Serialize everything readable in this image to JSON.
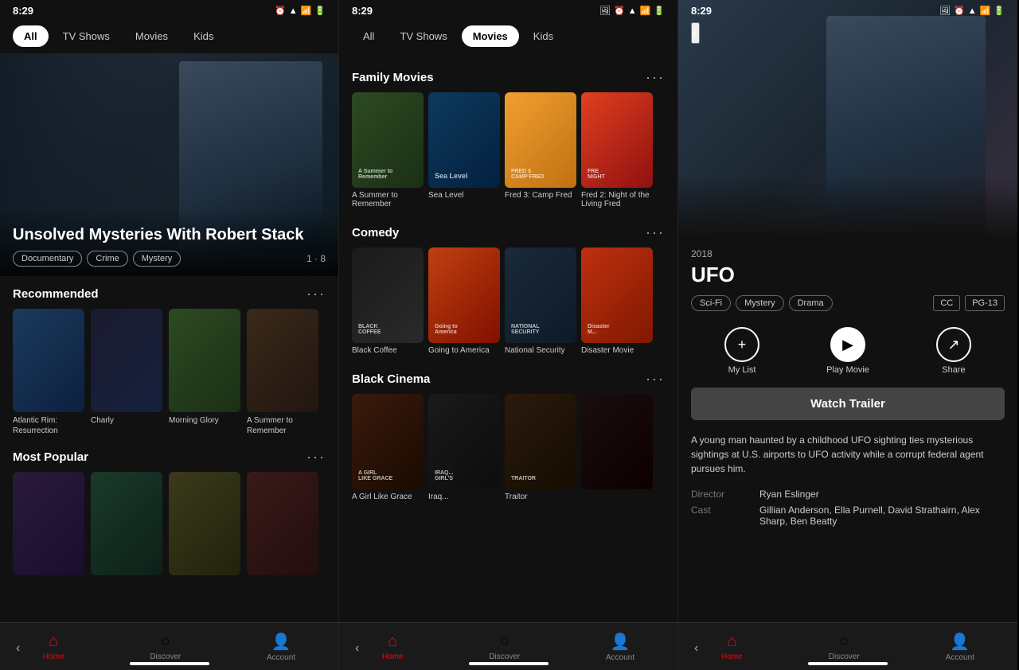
{
  "app": {
    "time": "8:29"
  },
  "panel1": {
    "tabs": [
      "All",
      "TV Shows",
      "Movies",
      "Kids"
    ],
    "active_tab": "All",
    "hero": {
      "title": "Unsolved Mysteries With Robert Stack",
      "tags": [
        "Documentary",
        "Crime",
        "Mystery"
      ],
      "episode": "1 · 8"
    },
    "recommended": {
      "title": "Recommended",
      "movies": [
        {
          "title": "Atlantic Rim: Resurrection",
          "thumb_class": "thumb-1"
        },
        {
          "title": "Charly",
          "thumb_class": "thumb-2"
        },
        {
          "title": "Morning Glory",
          "thumb_class": "thumb-3"
        },
        {
          "title": "A Summer to Remember",
          "thumb_class": "thumb-4"
        }
      ]
    },
    "most_popular": {
      "title": "Most Popular",
      "movies": [
        {
          "title": "",
          "thumb_class": "thumb-5"
        },
        {
          "title": "",
          "thumb_class": "thumb-6"
        },
        {
          "title": "",
          "thumb_class": "thumb-7"
        },
        {
          "title": "",
          "thumb_class": "thumb-8"
        }
      ]
    },
    "nav": {
      "home": "Home",
      "discover": "Discover",
      "account": "Account"
    }
  },
  "panel2": {
    "tabs": [
      "All",
      "TV Shows",
      "Movies",
      "Kids"
    ],
    "active_tab": "Movies",
    "family_movies": {
      "title": "Family Movies",
      "movies": [
        {
          "title": "A Summer to Remember",
          "thumb_class": "fam-1"
        },
        {
          "title": "Sea Level",
          "thumb_class": "fam-2"
        },
        {
          "title": "Fred 3: Camp Fred",
          "thumb_class": "fam-3"
        },
        {
          "title": "Fred 2: Night of the Living Fred",
          "thumb_class": "fam-4"
        }
      ]
    },
    "comedy": {
      "title": "Comedy",
      "movies": [
        {
          "title": "Black Coffee",
          "thumb_class": "com-1"
        },
        {
          "title": "Going to America",
          "thumb_class": "com-2"
        },
        {
          "title": "National Security",
          "thumb_class": "com-3"
        },
        {
          "title": "Disaster Movie",
          "thumb_class": "com-4"
        }
      ]
    },
    "black_cinema": {
      "title": "Black Cinema",
      "movies": [
        {
          "title": "A Girl Like Grace",
          "thumb_class": "bc-1"
        },
        {
          "title": "Iraq...",
          "thumb_class": "bc-2"
        },
        {
          "title": "Traitor",
          "thumb_class": "bc-3"
        },
        {
          "title": "",
          "thumb_class": "bc-4"
        }
      ]
    },
    "nav": {
      "home": "Home",
      "discover": "Discover",
      "account": "Account"
    }
  },
  "panel3": {
    "back_icon": "‹",
    "year": "2018",
    "title": "UFO",
    "tags": [
      "Sci-Fi",
      "Mystery",
      "Drama"
    ],
    "cc_badge": "CC",
    "rating": "PG-13",
    "actions": {
      "my_list": "My List",
      "play_movie": "Play Movie",
      "share": "Share"
    },
    "watch_trailer": "Watch Trailer",
    "description": "A young man haunted by a childhood UFO sighting ties mysterious sightings at U.S. airports to UFO activity while a corrupt federal agent pursues him.",
    "director_label": "Director",
    "director_value": "Ryan Eslinger",
    "cast_label": "Cast",
    "cast_value": "Gillian Anderson, Ella Purnell, David Strathairn, Alex Sharp, Ben Beatty",
    "nav": {
      "home": "Home",
      "discover": "Discover",
      "account": "Account"
    }
  }
}
